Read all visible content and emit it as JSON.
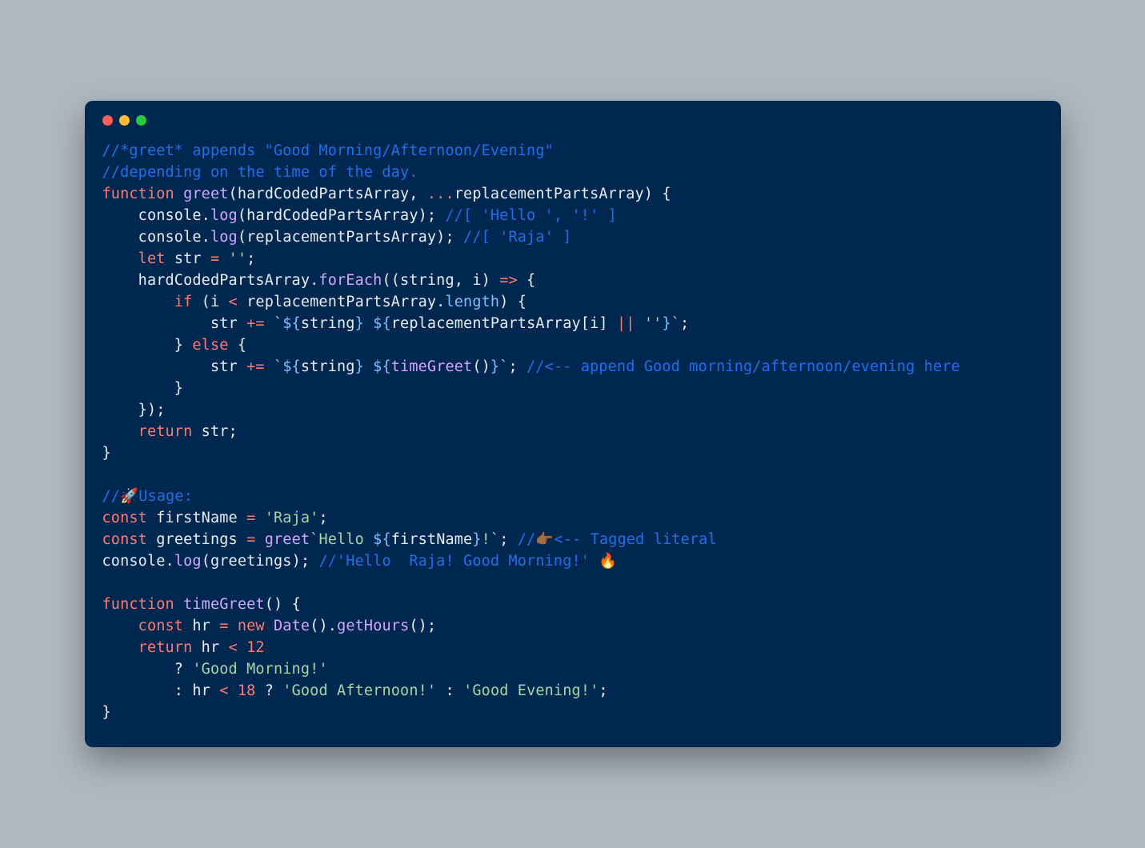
{
  "traffic_light": {
    "close": "close",
    "min": "minimize",
    "max": "maximize"
  },
  "code": {
    "l01_a": "//*greet* appends \"Good Morning/Afternoon/Evening\"",
    "l02_a": "//depending on the time of the day.",
    "l03_a": "function",
    "l03_b": " greet",
    "l03_c": "(hardCodedPartsArray, ",
    "l03_d": "...",
    "l03_e": "replacementPartsArray) {",
    "l04_a": "    console.",
    "l04_b": "log",
    "l04_c": "(hardCodedPartsArray); ",
    "l04_d": "//[ 'Hello ', '!' ]",
    "l05_a": "    console.",
    "l05_b": "log",
    "l05_c": "(replacementPartsArray); ",
    "l05_d": "//[ 'Raja' ]",
    "l06_a": "    ",
    "l06_b": "let",
    "l06_c": " str ",
    "l06_d": "=",
    "l06_e": " ''",
    "l06_f": ";",
    "l07_a": "    hardCodedPartsArray.",
    "l07_b": "forEach",
    "l07_c": "((string, i) ",
    "l07_d": "=>",
    "l07_e": " {",
    "l08_a": "        ",
    "l08_b": "if",
    "l08_c": " (i ",
    "l08_d": "<",
    "l08_e": " replacementPartsArray.",
    "l08_f": "length",
    "l08_g": ") {",
    "l09_a": "            str ",
    "l09_b": "+=",
    "l09_c": " `",
    "l09_d": "${",
    "l09_e": "string",
    "l09_f": "}",
    "l09_g": " ",
    "l09_h": "${",
    "l09_i": "replacementPartsArray[i] ",
    "l09_j": "||",
    "l09_k": " ''",
    "l09_l": "}",
    "l09_m": "`",
    "l09_n": ";",
    "l10_a": "        } ",
    "l10_b": "else",
    "l10_c": " {",
    "l11_a": "            str ",
    "l11_b": "+=",
    "l11_c": " `",
    "l11_d": "${",
    "l11_e": "string",
    "l11_f": "}",
    "l11_g": " ",
    "l11_h": "${",
    "l11_i": "timeGreet",
    "l11_j": "()",
    "l11_k": "}",
    "l11_l": "`",
    "l11_m": "; ",
    "l11_n": "//<-- append Good morning/afternoon/evening here",
    "l12_a": "        }",
    "l13_a": "    });",
    "l14_a": "    ",
    "l14_b": "return",
    "l14_c": " str;",
    "l15_a": "}",
    "l17_a": "//🚀Usage:",
    "l18_a": "const",
    "l18_b": " firstName ",
    "l18_c": "=",
    "l18_d": " 'Raja'",
    "l18_e": ";",
    "l19_a": "const",
    "l19_b": " greetings ",
    "l19_c": "=",
    "l19_d": " greet",
    "l19_e": "`Hello ",
    "l19_f": "${",
    "l19_g": "firstName",
    "l19_h": "}",
    "l19_i": "!`",
    "l19_j": "; ",
    "l19_k": "//👉🏾<-- Tagged literal",
    "l20_a": "console.",
    "l20_b": "log",
    "l20_c": "(greetings); ",
    "l20_d": "//'Hello  Raja! Good Morning!' 🔥",
    "l22_a": "function",
    "l22_b": " timeGreet",
    "l22_c": "() {",
    "l23_a": "    ",
    "l23_b": "const",
    "l23_c": " hr ",
    "l23_d": "=",
    "l23_e": " ",
    "l23_f": "new",
    "l23_g": " Date",
    "l23_h": "().",
    "l23_i": "getHours",
    "l23_j": "();",
    "l24_a": "    ",
    "l24_b": "return",
    "l24_c": " hr ",
    "l24_d": "<",
    "l24_e": " ",
    "l24_f": "12",
    "l25_a": "        ? ",
    "l25_b": "'Good Morning!'",
    "l26_a": "        : hr ",
    "l26_b": "<",
    "l26_c": " ",
    "l26_d": "18",
    "l26_e": " ? ",
    "l26_f": "'Good Afternoon!'",
    "l26_g": " : ",
    "l26_h": "'Good Evening!'",
    "l26_i": ";",
    "l27_a": "}"
  }
}
